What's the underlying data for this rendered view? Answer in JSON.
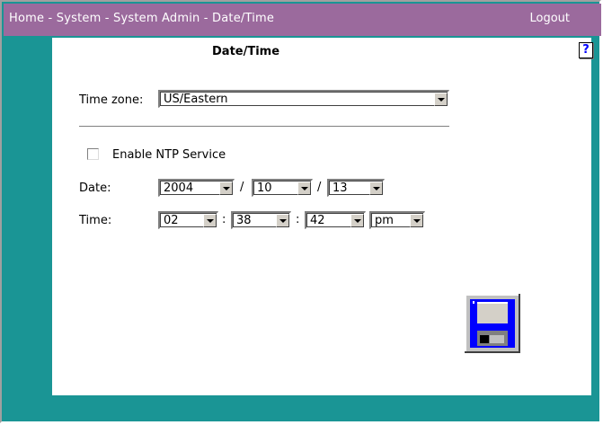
{
  "header": {
    "breadcrumb": [
      "Home",
      "System",
      "System Admin",
      "Date/Time"
    ],
    "separator": " - ",
    "logout": "Logout"
  },
  "page": {
    "title": "Date/Time",
    "help": "?"
  },
  "timezone": {
    "label": "Time zone:",
    "value": "US/Eastern"
  },
  "ntp": {
    "label": "Enable NTP Service",
    "checked": false
  },
  "date": {
    "label": "Date:",
    "year": "2004",
    "month": "10",
    "day": "13",
    "separator": "/"
  },
  "time": {
    "label": "Time:",
    "hour": "02",
    "minute": "38",
    "second": "42",
    "ampm": "pm",
    "separator": ":"
  },
  "icons": {
    "save": "floppy-disk-icon",
    "help": "help-icon"
  },
  "colors": {
    "header_bg": "#9b6a9d",
    "frame_bg": "#1a9595",
    "panel_bg": "#ffffff",
    "save_blue": "#0000ff"
  }
}
